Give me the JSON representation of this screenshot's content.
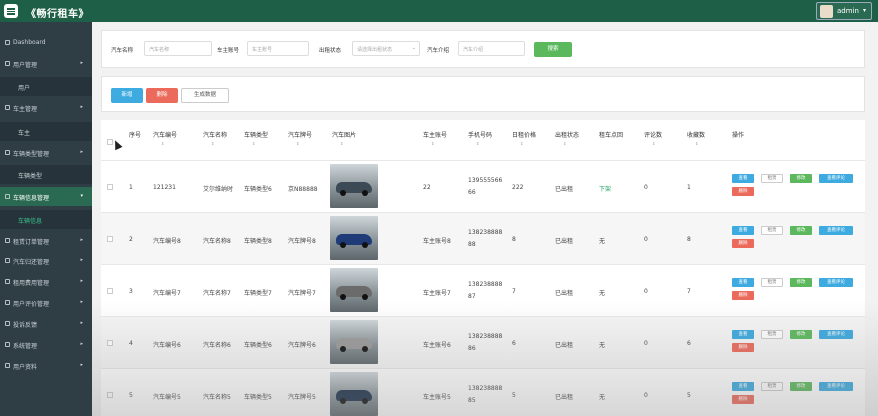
{
  "app": {
    "title": "《畅行租车》",
    "user": "admin",
    "user_caret": "▾"
  },
  "sidebar": {
    "items": [
      {
        "label": "Dashboard",
        "arrow": ""
      },
      {
        "label": "用户管理",
        "arrow": "▸"
      },
      {
        "label": "用户",
        "sub": true
      },
      {
        "label": "车主管理",
        "arrow": "▸"
      },
      {
        "label": "车主",
        "sub": true
      },
      {
        "label": "车辆类型管理",
        "arrow": "▸"
      },
      {
        "label": "车辆类型",
        "sub": true
      },
      {
        "label": "车辆信息管理",
        "arrow": "▾",
        "open": true
      },
      {
        "label": "车辆信息",
        "sub": true,
        "active": true
      },
      {
        "label": "租赁订单管理",
        "arrow": "▸"
      },
      {
        "label": "汽车归还管理",
        "arrow": "▸"
      },
      {
        "label": "租用费用管理",
        "arrow": "▸"
      },
      {
        "label": "用户评价管理",
        "arrow": "▸"
      },
      {
        "label": "投诉反馈",
        "arrow": "▸"
      },
      {
        "label": "系统管理",
        "arrow": "▸"
      },
      {
        "label": "用户资料",
        "arrow": "▸"
      }
    ]
  },
  "filters": {
    "car_name_label": "汽车名称",
    "car_name_placeholder": "汽车名称",
    "owner_account_label": "车主账号",
    "owner_account_placeholder": "车主账号",
    "rent_status_label": "出租状态",
    "rent_status_placeholder": "请选择出租状态",
    "car_intro_label": "汽车介绍",
    "car_intro_placeholder": "汽车介绍",
    "search_button": "搜索"
  },
  "actions": {
    "add": "新增",
    "delete": "删除",
    "generate": "生成数据"
  },
  "table": {
    "headers": [
      "序号",
      "汽车编号",
      "汽车名称",
      "车辆类型",
      "汽车牌号",
      "汽车图片",
      "车主账号",
      "手机号码",
      "日租价格",
      "出租状态",
      "租车点回",
      "评论数",
      "收藏数",
      "操作"
    ],
    "sort_glyph": "⇕",
    "row_buttons": {
      "view": "查看",
      "detail": "租赁",
      "edit": "修改",
      "comment": "查看评论",
      "del": "删除"
    },
    "rows": [
      {
        "idx": "1",
        "code": "121231",
        "name": "艾尔维纳时",
        "type": "车辆类型6",
        "plate": "京N88888",
        "owner": "22",
        "phone1": "139555566",
        "phone2": "66",
        "price": "222",
        "status": "已出租",
        "flag": "下架",
        "comments": "0",
        "favs": "1",
        "car_color": "#3b4a55"
      },
      {
        "idx": "2",
        "code": "汽车编号8",
        "name": "汽车名称8",
        "type": "车辆类型8",
        "plate": "汽车牌号8",
        "owner": "车主账号8",
        "phone1": "138238888",
        "phone2": "88",
        "price": "8",
        "status": "已出租",
        "flag": "无",
        "comments": "0",
        "favs": "8",
        "car_color": "#1f3c78"
      },
      {
        "idx": "3",
        "code": "汽车编号7",
        "name": "汽车名称7",
        "type": "车辆类型7",
        "plate": "汽车牌号7",
        "owner": "车主账号7",
        "phone1": "138238888",
        "phone2": "87",
        "price": "7",
        "status": "已出租",
        "flag": "无",
        "comments": "0",
        "favs": "7",
        "car_color": "#6b6b6b"
      },
      {
        "idx": "4",
        "code": "汽车编号6",
        "name": "汽车名称6",
        "type": "车辆类型6",
        "plate": "汽车牌号6",
        "owner": "车主账号6",
        "phone1": "138238888",
        "phone2": "86",
        "price": "6",
        "status": "已出租",
        "flag": "无",
        "comments": "0",
        "favs": "6",
        "car_color": "#9a9a9a"
      },
      {
        "idx": "5",
        "code": "汽车编号5",
        "name": "汽车名称5",
        "type": "车辆类型5",
        "plate": "汽车牌号5",
        "owner": "车主账号5",
        "phone1": "138238888",
        "phone2": "85",
        "price": "5",
        "status": "已出租",
        "flag": "无",
        "comments": "0",
        "favs": "5",
        "car_color": "#1b2f4a"
      }
    ]
  }
}
